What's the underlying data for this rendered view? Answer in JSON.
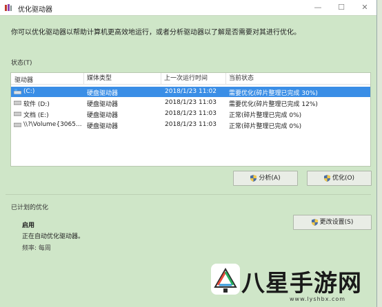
{
  "window": {
    "title": "优化驱动器",
    "minimize": "—",
    "maximize": "☐",
    "close": "✕"
  },
  "intro": "你可以优化驱动器以帮助计算机更高效地运行，或者分析驱动器以了解是否需要对其进行优化。",
  "status_label": "状态(T)",
  "table": {
    "headers": [
      "驱动器",
      "媒体类型",
      "上一次运行时间",
      "当前状态"
    ],
    "rows": [
      {
        "drive": "(C:)",
        "media": "硬盘驱动器",
        "last_run": "2018/1/23 11:02",
        "status": "需要优化(碎片整理已完成 30%)",
        "selected": true
      },
      {
        "drive": "软件 (D:)",
        "media": "硬盘驱动器",
        "last_run": "2018/1/23 11:03",
        "status": "需要优化(碎片整理已完成 12%)",
        "selected": false
      },
      {
        "drive": "文档 (E:)",
        "media": "硬盘驱动器",
        "last_run": "2018/1/23 11:03",
        "status": "正常(碎片整理已完成 0%)",
        "selected": false
      },
      {
        "drive": "\\\\?\\Volume{3065...",
        "media": "硬盘驱动器",
        "last_run": "2018/1/23 11:03",
        "status": "正常(碎片整理已完成 0%)",
        "selected": false
      }
    ]
  },
  "buttons": {
    "analyze": "分析(A)",
    "optimize": "优化(O)",
    "change_settings": "更改设置(S)"
  },
  "scheduled": {
    "label": "已计划的优化",
    "state": "启用",
    "description": "正在自动优化驱动器。",
    "frequency": "频率: 每周"
  },
  "watermark": {
    "text": "八星手游网",
    "url": "www.lyshbx.com"
  },
  "colors": {
    "window_bg": "#cfe6c8",
    "selection": "#3a8ee6",
    "titlebar": "#ffffff"
  }
}
